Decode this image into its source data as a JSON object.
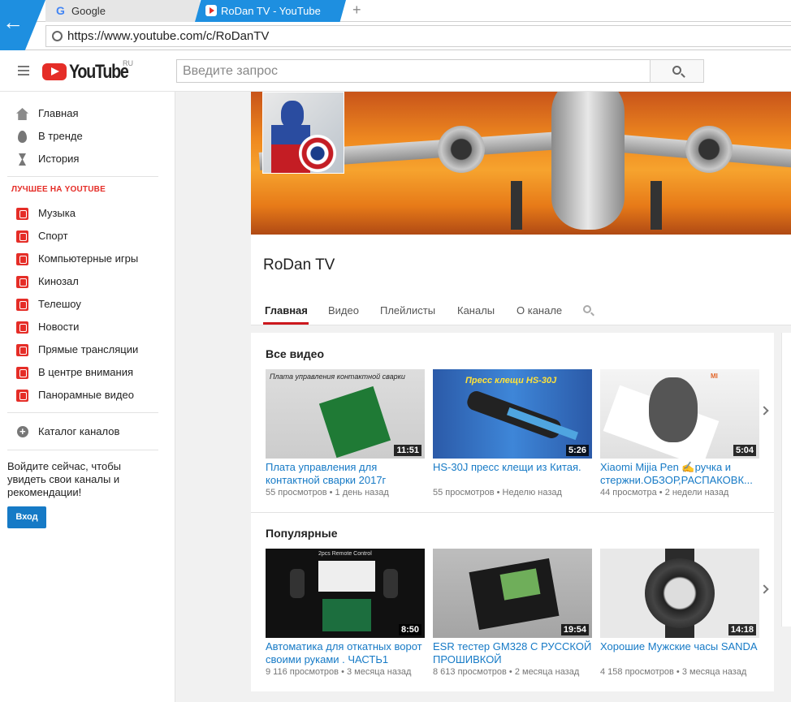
{
  "browser": {
    "tabs": [
      {
        "title": "Google",
        "active": false
      },
      {
        "title": "RoDan TV - YouTube",
        "active": true
      }
    ],
    "new_tab": "+",
    "url": "https://www.youtube.com/c/RoDanTV",
    "accent": "#1e8fe0"
  },
  "header": {
    "logo_text": "YouTube",
    "country": "RU",
    "search_placeholder": "Введите запрос",
    "brand_color": "#e52d27"
  },
  "sidebar": {
    "main": [
      {
        "label": "Главная",
        "icon": "home-icon"
      },
      {
        "label": "В тренде",
        "icon": "trending-icon"
      },
      {
        "label": "История",
        "icon": "history-icon"
      }
    ],
    "best_header": "ЛУЧШЕЕ НА YOUTUBE",
    "best": [
      {
        "label": "Музыка",
        "icon": "music-icon"
      },
      {
        "label": "Спорт",
        "icon": "sport-icon"
      },
      {
        "label": "Компьютерные игры",
        "icon": "gaming-icon"
      },
      {
        "label": "Кинозал",
        "icon": "movies-icon"
      },
      {
        "label": "Телешоу",
        "icon": "tv-icon"
      },
      {
        "label": "Новости",
        "icon": "news-icon"
      },
      {
        "label": "Прямые трансляции",
        "icon": "live-icon"
      },
      {
        "label": "В центре внимания",
        "icon": "spotlight-icon"
      },
      {
        "label": "Панорамные видео",
        "icon": "360-icon"
      }
    ],
    "catalog": "Каталог каналов",
    "signin_text": "Войдите сейчас, чтобы увидеть свои каналы и рекомендации!",
    "signin_button": "Вход"
  },
  "channel": {
    "name": "RoDan TV",
    "tabs": [
      "Главная",
      "Видео",
      "Плейлисты",
      "Каналы",
      "О канале"
    ],
    "active_tab": "Главная"
  },
  "sections": [
    {
      "title": "Все видео",
      "videos": [
        {
          "title": "Плата управления для контактной сварки 2017г",
          "duration": "11:51",
          "views": "55 просмотров",
          "age": "1 день назад",
          "thumb_caption": "Плата управления контактной сварки"
        },
        {
          "title": "HS-30J пресс клещи из Китая.",
          "duration": "5:26",
          "views": "55 просмотров",
          "age": "Неделю назад",
          "thumb_caption": "Пресс клещи HS-30J"
        },
        {
          "title": "Xiaomi Mijia Pen ✍ручка и стержни.ОБЗОР,РАСПАКОВК...",
          "duration": "5:04",
          "views": "44 просмотра",
          "age": "2 недели назад",
          "thumb_caption": "MI"
        }
      ]
    },
    {
      "title": "Популярные",
      "videos": [
        {
          "title": "Автоматика для откатных ворот своими руками . ЧАСТЬ1",
          "duration": "8:50",
          "views": "9 116 просмотров",
          "age": "3 месяца назад",
          "thumb_caption": "2pcs Remote Control"
        },
        {
          "title": "ESR тестер GM328 С РУССКОЙ ПРОШИВКОЙ",
          "duration": "19:54",
          "views": "8 613 просмотров",
          "age": "2 месяца назад",
          "thumb_caption": ""
        },
        {
          "title": "Хорошие Мужские часы SANDA",
          "duration": "14:18",
          "views": "4 158 просмотров",
          "age": "3 месяца назад",
          "thumb_caption": ""
        }
      ]
    }
  ],
  "meta_separator": "•"
}
